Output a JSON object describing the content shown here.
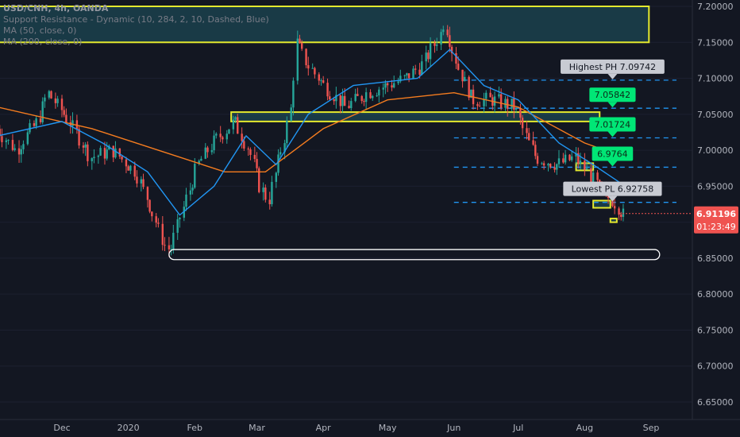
{
  "header": {
    "symbol": "USD/CNH, 4h, OANDA",
    "indicator_sr": "Support Resistance - Dynamic (10, 284, 2, 10, Dashed, Blue)",
    "indicator_ma50": "MA (50, close, 0)",
    "indicator_ma200": "MA (200, close, 0)"
  },
  "colors": {
    "background": "#131722",
    "up": "#26a69a",
    "down": "#ef5350",
    "ma50": "#2196f3",
    "ma200": "#f57c1f",
    "sr_line": "#2196f3",
    "zone": "#e4e92e",
    "marker_green": "#00e676",
    "marker_grey": "#c8cbd3",
    "price_label": "#ef5350",
    "ellipse": "#ffffff",
    "axis_text": "#b2b5be"
  },
  "chart_data": {
    "type": "candlestick",
    "title": "USD/CNH, 4h, OANDA",
    "ylim": [
      6.6,
      7.22
    ],
    "y_ticks": [
      "7.20000",
      "7.15000",
      "7.10000",
      "7.05000",
      "7.00000",
      "6.95000",
      "6.90000",
      "6.85000",
      "6.80000",
      "6.75000",
      "6.70000",
      "6.65000"
    ],
    "x_ticks": [
      "Dec",
      "2020",
      "Feb",
      "Mar",
      "Apr",
      "May",
      "Jun",
      "Jul",
      "Aug",
      "Sep"
    ],
    "price_path": [
      [
        "2019-11-01",
        7.03
      ],
      [
        "2019-11-10",
        7.0
      ],
      [
        "2019-11-20",
        7.04
      ],
      [
        "2019-11-25",
        7.08
      ],
      [
        "2019-12-05",
        7.04
      ],
      [
        "2019-12-15",
        6.99
      ],
      [
        "2019-12-25",
        7.0
      ],
      [
        "2020-01-05",
        6.97
      ],
      [
        "2020-01-12",
        6.92
      ],
      [
        "2020-01-18",
        6.87
      ],
      [
        "2020-01-21",
        6.86
      ],
      [
        "2020-01-26",
        6.91
      ],
      [
        "2020-02-03",
        6.98
      ],
      [
        "2020-02-10",
        7.01
      ],
      [
        "2020-02-20",
        7.04
      ],
      [
        "2020-02-27",
        7.0
      ],
      [
        "2020-03-03",
        6.95
      ],
      [
        "2020-03-07",
        6.93
      ],
      [
        "2020-03-12",
        6.99
      ],
      [
        "2020-03-17",
        7.05
      ],
      [
        "2020-03-20",
        7.15
      ],
      [
        "2020-03-25",
        7.12
      ],
      [
        "2020-04-02",
        7.09
      ],
      [
        "2020-04-12",
        7.06
      ],
      [
        "2020-04-22",
        7.08
      ],
      [
        "2020-05-01",
        7.09
      ],
      [
        "2020-05-10",
        7.1
      ],
      [
        "2020-05-18",
        7.12
      ],
      [
        "2020-05-26",
        7.16
      ],
      [
        "2020-05-28",
        7.18
      ],
      [
        "2020-06-03",
        7.12
      ],
      [
        "2020-06-10",
        7.07
      ],
      [
        "2020-06-20",
        7.07
      ],
      [
        "2020-06-30",
        7.06
      ],
      [
        "2020-07-05",
        7.02
      ],
      [
        "2020-07-10",
        6.99
      ],
      [
        "2020-07-20",
        6.98
      ],
      [
        "2020-07-28",
        6.99
      ],
      [
        "2020-08-03",
        6.97
      ],
      [
        "2020-08-10",
        6.94
      ],
      [
        "2020-08-15",
        6.93
      ],
      [
        "2020-08-20",
        6.91
      ]
    ],
    "ma50_path": [
      [
        "2019-11-01",
        7.02
      ],
      [
        "2019-12-01",
        7.04
      ],
      [
        "2019-12-20",
        7.01
      ],
      [
        "2020-01-10",
        6.97
      ],
      [
        "2020-01-25",
        6.91
      ],
      [
        "2020-02-10",
        6.95
      ],
      [
        "2020-02-25",
        7.02
      ],
      [
        "2020-03-10",
        6.98
      ],
      [
        "2020-03-25",
        7.05
      ],
      [
        "2020-04-15",
        7.09
      ],
      [
        "2020-05-15",
        7.1
      ],
      [
        "2020-05-30",
        7.14
      ],
      [
        "2020-06-15",
        7.09
      ],
      [
        "2020-07-01",
        7.07
      ],
      [
        "2020-07-20",
        7.01
      ],
      [
        "2020-08-05",
        6.98
      ],
      [
        "2020-08-20",
        6.95
      ]
    ],
    "ma200_path": [
      [
        "2019-11-01",
        7.06
      ],
      [
        "2019-12-15",
        7.03
      ],
      [
        "2020-01-15",
        7.0
      ],
      [
        "2020-02-15",
        6.97
      ],
      [
        "2020-03-05",
        6.97
      ],
      [
        "2020-04-01",
        7.03
      ],
      [
        "2020-05-01",
        7.07
      ],
      [
        "2020-06-01",
        7.08
      ],
      [
        "2020-07-01",
        7.06
      ],
      [
        "2020-08-01",
        7.01
      ],
      [
        "2020-08-20",
        6.99
      ]
    ],
    "sr_levels": [
      7.09742,
      7.05842,
      7.01724,
      6.9764,
      6.92758
    ],
    "zones": [
      {
        "start": "2019-11-01",
        "end": "2020-08-31",
        "low": 7.15,
        "high": 7.2
      },
      {
        "start": "2020-02-18",
        "end": "2020-08-08",
        "low": 7.04,
        "high": 7.053
      },
      {
        "start": "2020-07-28",
        "end": "2020-08-05",
        "low": 6.972,
        "high": 6.982
      },
      {
        "start": "2020-08-05",
        "end": "2020-08-13",
        "low": 6.92,
        "high": 6.93
      },
      {
        "start": "2020-08-13",
        "end": "2020-08-16",
        "low": 6.9,
        "high": 6.905
      }
    ],
    "level_labels": [
      {
        "text": "Highest PH 7.09742",
        "value": 7.09742,
        "style": "grey"
      },
      {
        "text": "7.05842",
        "value": 7.05842,
        "style": "green"
      },
      {
        "text": "7.01724",
        "value": 7.01724,
        "style": "green"
      },
      {
        "text": "6.9764",
        "value": 6.9764,
        "style": "green"
      },
      {
        "text": "Lowest PL 6.92758",
        "value": 6.92758,
        "style": "grey"
      }
    ],
    "ellipse": {
      "start": "2020-01-20",
      "end": "2020-09-05",
      "low": 6.848,
      "high": 6.862
    },
    "last_price": {
      "value": 6.91196,
      "label": "6.91196",
      "countdown": "01:23:49"
    }
  }
}
